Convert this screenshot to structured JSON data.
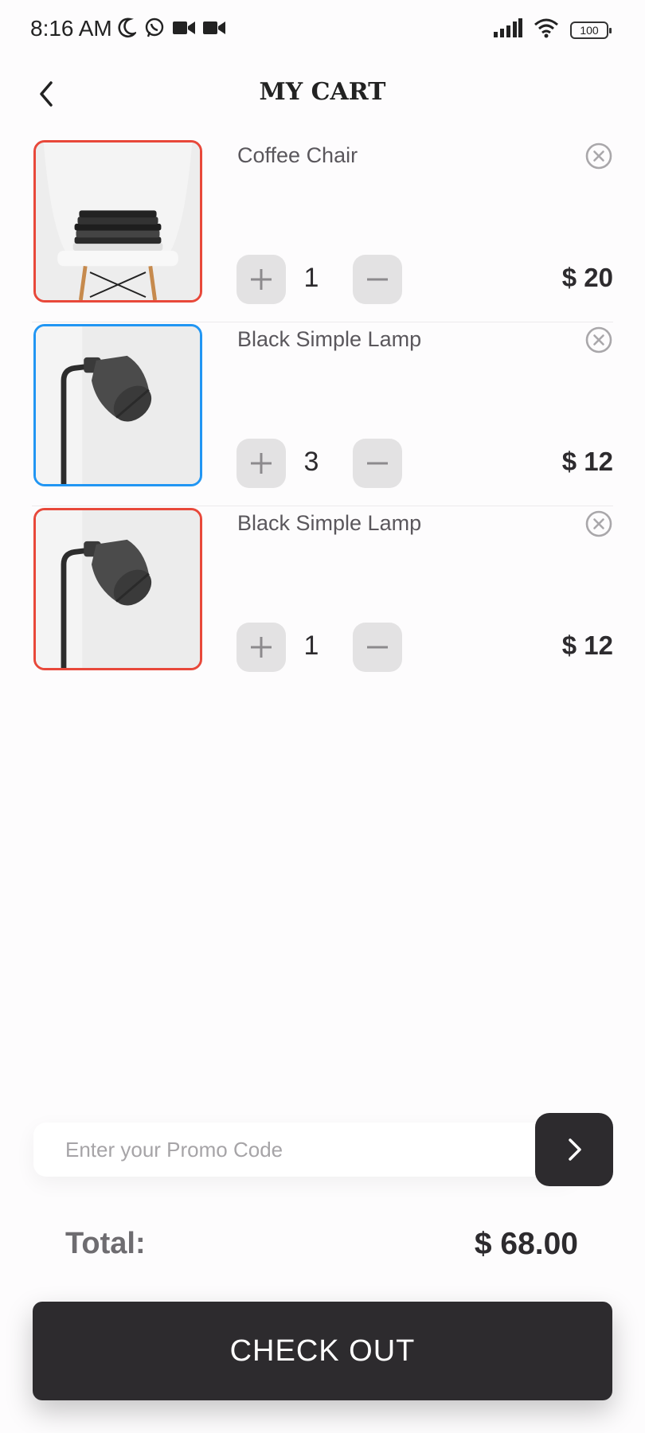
{
  "status_bar": {
    "time": "8:16 AM",
    "left_icons": [
      "moon-icon",
      "whatsapp-icon",
      "video-camera-icon",
      "video-camera-icon"
    ],
    "right_icons": [
      "signal-icon",
      "wifi-icon"
    ],
    "battery": "100"
  },
  "header": {
    "title": "MY CART",
    "back_icon": "chevron-left-icon"
  },
  "cart": {
    "items": [
      {
        "name": "Coffee Chair",
        "quantity": "1",
        "price": "$ 20",
        "image": "chair-with-folded-clothes",
        "selected": false
      },
      {
        "name": "Black Simple Lamp",
        "quantity": "3",
        "price": "$ 12",
        "image": "black-floor-lamp",
        "selected": true
      },
      {
        "name": "Black Simple Lamp",
        "quantity": "1",
        "price": "$ 12",
        "image": "black-floor-lamp",
        "selected": false
      }
    ],
    "icons": {
      "plus": "plus-icon",
      "minus": "minus-icon",
      "remove": "close-circle-icon"
    }
  },
  "promo": {
    "placeholder": "Enter your Promo Code",
    "value": "",
    "submit_icon": "chevron-right-icon"
  },
  "summary": {
    "total_label": "Total:",
    "total_value": "$ 68.00"
  },
  "checkout": {
    "label": "CHECK OUT"
  },
  "colors": {
    "dark": "#2d2b2e",
    "border_default": "#e8483a",
    "border_selected": "#2196f3",
    "qty_button_bg": "#e3e2e3",
    "background": "#fdfcfd"
  }
}
